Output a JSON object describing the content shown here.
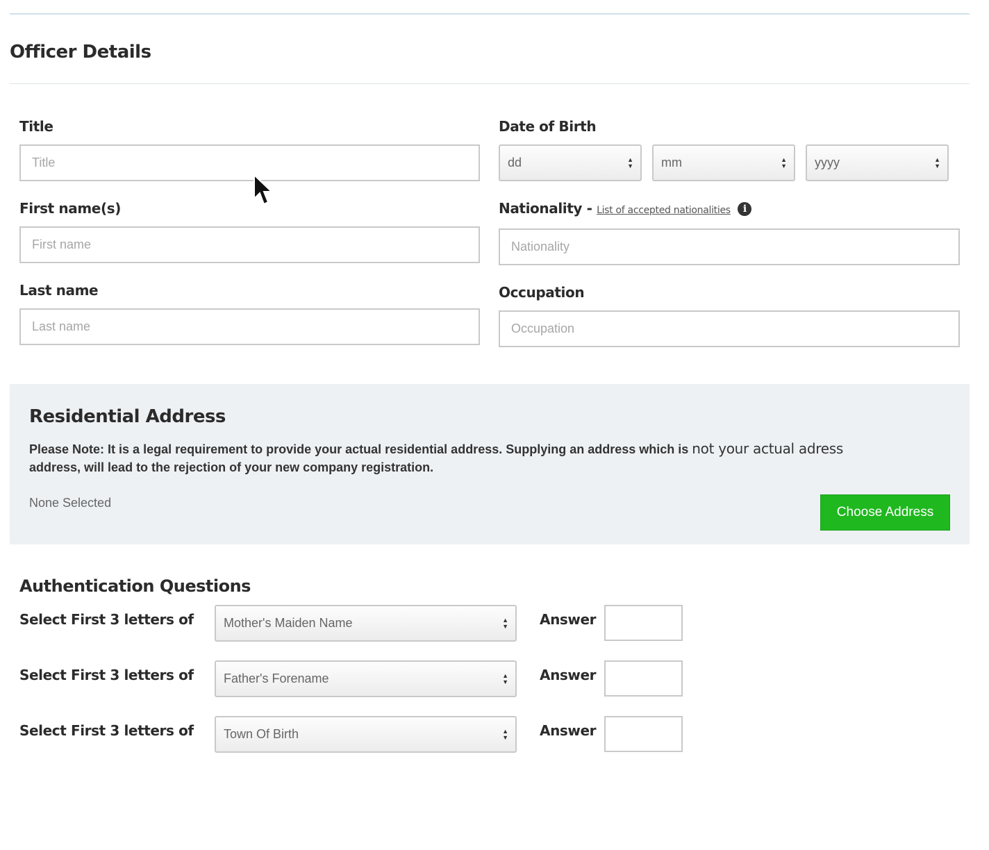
{
  "officer_details": {
    "heading": "Officer Details",
    "title": {
      "label": "Title",
      "placeholder": "Title"
    },
    "first_name": {
      "label": "First name(s)",
      "placeholder": "First name"
    },
    "last_name": {
      "label": "Last name",
      "placeholder": "Last name"
    },
    "dob": {
      "label": "Date of Birth",
      "day": "dd",
      "month": "mm",
      "year": "yyyy"
    },
    "nationality": {
      "label": "Nationality -",
      "link_text": "List of accepted nationalities",
      "info_icon": "info-icon",
      "placeholder": "Nationality"
    },
    "occupation": {
      "label": "Occupation",
      "placeholder": "Occupation"
    }
  },
  "residential_address": {
    "heading": "Residential Address",
    "note": "Please Note: It is a legal requirement to provide your actual residential address. Supplying an address which is",
    "note_insert": "not your actual adress",
    "note_end": "address, will lead to the rejection of your new company registration.",
    "status": "None Selected",
    "choose_button": "Choose Address",
    "panel_color": "#eef1f4",
    "button_color": "#1fb81f"
  },
  "authentication": {
    "heading": "Authentication Questions",
    "questions": [
      {
        "label": "Select First 3 letters of",
        "selected": "Mother's Maiden Name",
        "answer_label": "Answer",
        "answer": ""
      },
      {
        "label": "Select First 3 letters of",
        "selected": "Father's Forename",
        "answer_label": "Answer",
        "answer": ""
      },
      {
        "label": "Select First 3 letters of",
        "selected": "Town Of Birth",
        "answer_label": "Answer",
        "answer": ""
      }
    ]
  },
  "icons": {
    "select_arrows": "updown-arrows-icon",
    "cursor": "mouse-pointer-icon"
  }
}
